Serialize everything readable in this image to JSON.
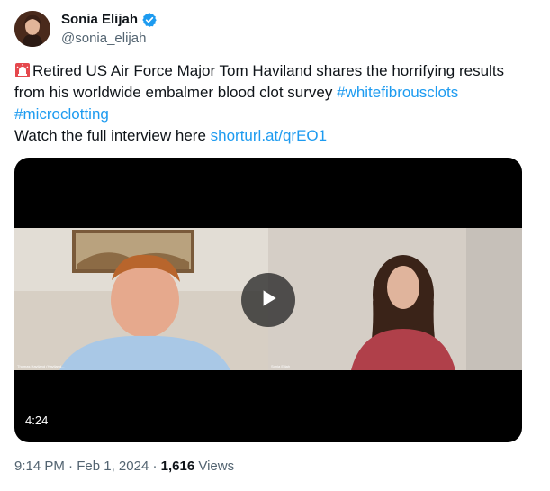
{
  "author": {
    "display_name": "Sonia Elijah",
    "handle": "@sonia_elijah",
    "verified": true,
    "verified_color": "#1d9bf0"
  },
  "tweet": {
    "line1_text": "Retired US Air Force Major Tom Haviland shares the horrifying results",
    "line2_text": "from his worldwide embalmer blood clot survey ",
    "hashtag1": "#whitefibrousclots",
    "hashtag2": "#microclotting",
    "line4_text": "Watch the full interview here ",
    "link": "shorturl.at/qrEO1",
    "link_color": "#1d9bf0",
    "leading_emoji": "siren-icon"
  },
  "media": {
    "duration": "4:24",
    "left_camera_label": "Thomas Haviland (Haviland...",
    "right_camera_label": "Sonia Elijah"
  },
  "meta": {
    "time": "9:14 PM",
    "separator": "·",
    "date": "Feb 1, 2024",
    "views_count": "1,616",
    "views_label": "Views"
  }
}
